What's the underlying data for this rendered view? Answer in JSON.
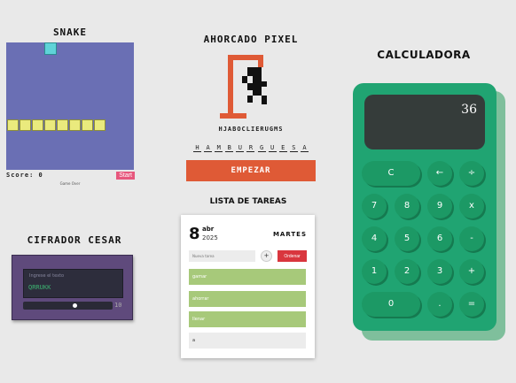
{
  "snake": {
    "title": "SNAKE",
    "score_label": "Score: 0",
    "start_label": "Start",
    "game_over": "Game Over"
  },
  "cesar": {
    "title": "CIFRADOR CESAR",
    "input_placeholder": "Ingrese el texto",
    "output": "QRRUKK",
    "shift": "10"
  },
  "hangman": {
    "title": "AHORCADO PIXEL",
    "letters_used": "HJABOCLIERUGMS",
    "word": [
      "H",
      "A",
      "M",
      "B",
      "U",
      "R",
      "G",
      "U",
      "E",
      "S",
      "A"
    ],
    "start_label": "EMPEZAR"
  },
  "todo": {
    "title": "LISTA DE TAREAS",
    "day": "8",
    "month": "abr",
    "year": "2025",
    "weekday": "MARTES",
    "new_placeholder": "Nueva tarea",
    "add_label": "+",
    "order_label": "Ordenar",
    "tasks": [
      "gamar",
      "ahorrar",
      "llenar",
      "a"
    ]
  },
  "calculator": {
    "title": "CALCULADORA",
    "display": "36",
    "keys": [
      "C",
      "←",
      "÷",
      "7",
      "8",
      "9",
      "x",
      "4",
      "5",
      "6",
      "-",
      "1",
      "2",
      "3",
      "+",
      "0",
      ".",
      "="
    ]
  },
  "colors": {
    "snake_board": "#6a6fb4",
    "snake_body": "#eaea7d",
    "snake_food": "#5fd3d8",
    "cesar_bg": "#5f4a7c",
    "hangman_accent": "#df5a36",
    "todo_task": "#a7c97a",
    "calc_body": "#20a472"
  }
}
